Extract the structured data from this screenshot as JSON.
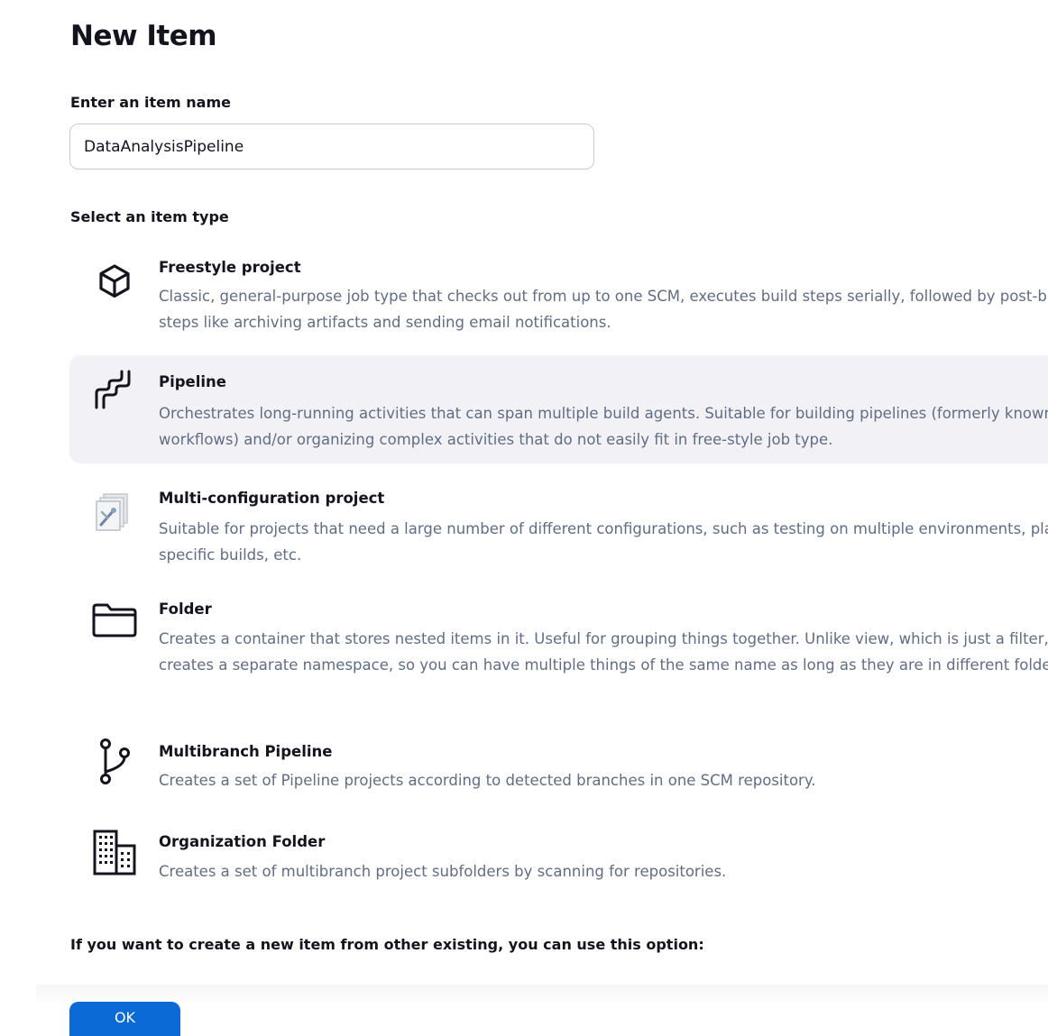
{
  "page": {
    "title": "New Item"
  },
  "name_field": {
    "label": "Enter an item name",
    "value": "DataAnalysisPipeline"
  },
  "item_type": {
    "label": "Select an item type",
    "selected": "Pipeline",
    "items": [
      {
        "name": "Freestyle project",
        "icon": "freestyle-cube-icon",
        "description": "Classic, general-purpose job type that checks out from up to one SCM, executes build steps serially, followed by post-build steps like archiving artifacts and sending email notifications."
      },
      {
        "name": "Pipeline",
        "icon": "pipeline-icon",
        "description": "Orchestrates long-running activities that can span multiple build agents. Suitable for building pipelines (formerly known as workflows) and/or organizing complex activities that do not easily fit in free-style job type."
      },
      {
        "name": "Multi-configuration project",
        "icon": "multi-configuration-icon",
        "description": "Suitable for projects that need a large number of different configurations, such as testing on multiple environments, platform-specific builds, etc."
      },
      {
        "name": "Folder",
        "icon": "folder-icon",
        "description": "Creates a container that stores nested items in it. Useful for grouping things together. Unlike view, which is just a filter, a folder creates a separate namespace, so you can have multiple things of the same name as long as they are in different folders."
      },
      {
        "name": "Multibranch Pipeline",
        "icon": "branch-icon",
        "description": "Creates a set of Pipeline projects according to detected branches in one SCM repository."
      },
      {
        "name": "Organization Folder",
        "icon": "organization-building-icon",
        "description": "Creates a set of multibranch project subfolders by scanning for repositories."
      }
    ]
  },
  "copy_option": {
    "label": "If you want to create a new item from other existing, you can use this option:"
  },
  "actions": {
    "ok_label": "OK"
  },
  "colors": {
    "primary_button": "#0b6ad6",
    "selected_item_bg": "#f2f2f6",
    "description_text": "#5f6d85"
  }
}
